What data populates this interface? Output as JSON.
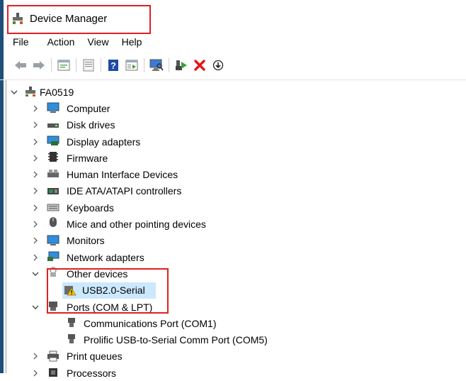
{
  "window": {
    "title": "Device Manager"
  },
  "menu": [
    "File",
    "Action",
    "View",
    "Help"
  ],
  "toolbar": [
    "back-icon",
    "forward-icon",
    "properties-icon",
    "update-driver-icon",
    "help-icon",
    "show-hidden-icon",
    "scan-icon",
    "enable-device-icon",
    "uninstall-icon",
    "download-icon"
  ],
  "tree": {
    "root": "FA0519",
    "categories": [
      {
        "label": "Computer",
        "expanded": false
      },
      {
        "label": "Disk drives",
        "expanded": false
      },
      {
        "label": "Display adapters",
        "expanded": false
      },
      {
        "label": "Firmware",
        "expanded": false
      },
      {
        "label": "Human Interface Devices",
        "expanded": false
      },
      {
        "label": "IDE ATA/ATAPI controllers",
        "expanded": false
      },
      {
        "label": "Keyboards",
        "expanded": false
      },
      {
        "label": "Mice and other pointing devices",
        "expanded": false
      },
      {
        "label": "Monitors",
        "expanded": false
      },
      {
        "label": "Network adapters",
        "expanded": false
      },
      {
        "label": "Other devices",
        "expanded": true,
        "children": [
          "USB2.0-Serial"
        ]
      },
      {
        "label": "Ports (COM & LPT)",
        "expanded": true,
        "children": [
          "Communications Port (COM1)",
          "Prolific USB-to-Serial Comm Port (COM5)"
        ]
      },
      {
        "label": "Print queues",
        "expanded": false
      },
      {
        "label": "Processors",
        "expanded": false
      }
    ]
  },
  "colors": {
    "highlight_box": "#e02020",
    "selection": "#cce8ff"
  }
}
